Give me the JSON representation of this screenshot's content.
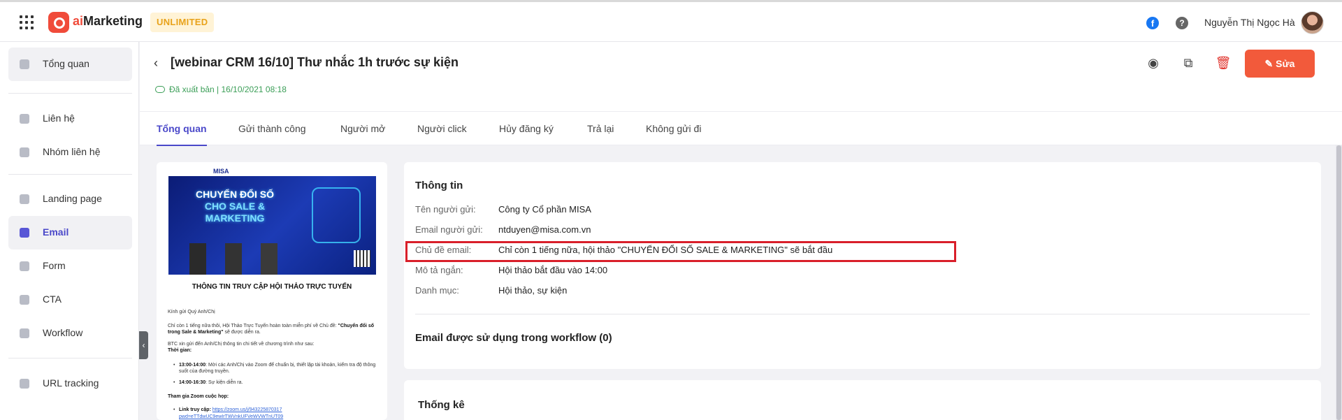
{
  "app": {
    "logo_prefix": "ai",
    "logo_name": "Marketing",
    "plan_badge": "UNLIMITED",
    "user_name": "Nguyễn Thị Ngọc Hà",
    "brand_color": "#f04b3a",
    "accent_color": "#4a48c9"
  },
  "sidebar": {
    "items": [
      {
        "label": "Tổng quan",
        "icon": "chart-icon"
      },
      {
        "label": "Liên hệ",
        "icon": "person-icon"
      },
      {
        "label": "Nhóm liên hệ",
        "icon": "group-icon"
      },
      {
        "label": "Landing page",
        "icon": "layers-icon"
      },
      {
        "label": "Email",
        "icon": "mail-icon",
        "active": true
      },
      {
        "label": "Form",
        "icon": "form-icon"
      },
      {
        "label": "CTA",
        "icon": "cursor-icon"
      },
      {
        "label": "Workflow",
        "icon": "workflow-icon"
      },
      {
        "label": "URL tracking",
        "icon": "link-icon"
      }
    ]
  },
  "header": {
    "title": "[webinar CRM 16/10] Thư nhắc 1h trước sự kiện",
    "status": "Đã xuất bản | 16/10/2021 08:18",
    "edit_label": "Sửa"
  },
  "tabs": [
    "Tổng quan",
    "Gửi thành công",
    "Người mở",
    "Người click",
    "Hủy đăng ký",
    "Trả lại",
    "Không gửi đi"
  ],
  "preview": {
    "banner_brand": "MISA",
    "banner_line1": "CHUYỂN ĐỔI SỐ",
    "banner_line2": "CHO SALE & MARKETING",
    "heading": "THÔNG TIN TRUY CẬP HỘI THẢO TRỰC TUYẾN",
    "greeting": "Kính gửi Quý Anh/Chị",
    "intro": "Chỉ còn 1 tiếng nữa thôi, Hội Thảo Trực Tuyến hoàn toàn miễn phí về Chủ đề:",
    "intro_bold": "\"Chuyển đổi số trong Sale & Marketing\"",
    "intro_end": " sẽ được diễn ra.",
    "btc": "BTC xin gửi đến Anh/Chị thông tin chi tiết về chương trình như sau:",
    "time_label": "Thời gian:",
    "time1_bold": "13:00-14:00",
    "time1": ": Mời các Anh/Chị vào Zoom để chuẩn bị, thiết lập tài khoản, kiểm tra độ thông suốt của đường truyền.",
    "time2_bold": "14:00-16:30",
    "time2": ": Sự kiện diễn ra.",
    "zoom_label": "Tham gia Zoom cuộc họp:",
    "link_label": "Link truy cập: ",
    "link": "https://zoom.us/j/943225870317",
    "link2": "pwd=eTTdwUC9ewIrTWVnkUFVeWVWTnUT09"
  },
  "info": {
    "title": "Thông tin",
    "rows": [
      {
        "k": "Tên người gửi:",
        "v": "Công ty Cổ phần MISA"
      },
      {
        "k": "Email người gửi:",
        "v": "ntduyen@misa.com.vn"
      },
      {
        "k": "Chủ đề email:",
        "v": "Chỉ còn 1 tiếng nữa, hội thảo \"CHUYỂN ĐỔI SỐ SALE & MARKETING\" sẽ bắt đầu"
      },
      {
        "k": "Mô tả ngắn:",
        "v": "Hội thảo bắt đầu vào 14:00"
      },
      {
        "k": "Danh mục:",
        "v": "Hội thảo, sự kiện"
      }
    ],
    "workflow_title": "Email được sử dụng trong workflow (0)"
  },
  "stats": {
    "title": "Thống kê"
  }
}
